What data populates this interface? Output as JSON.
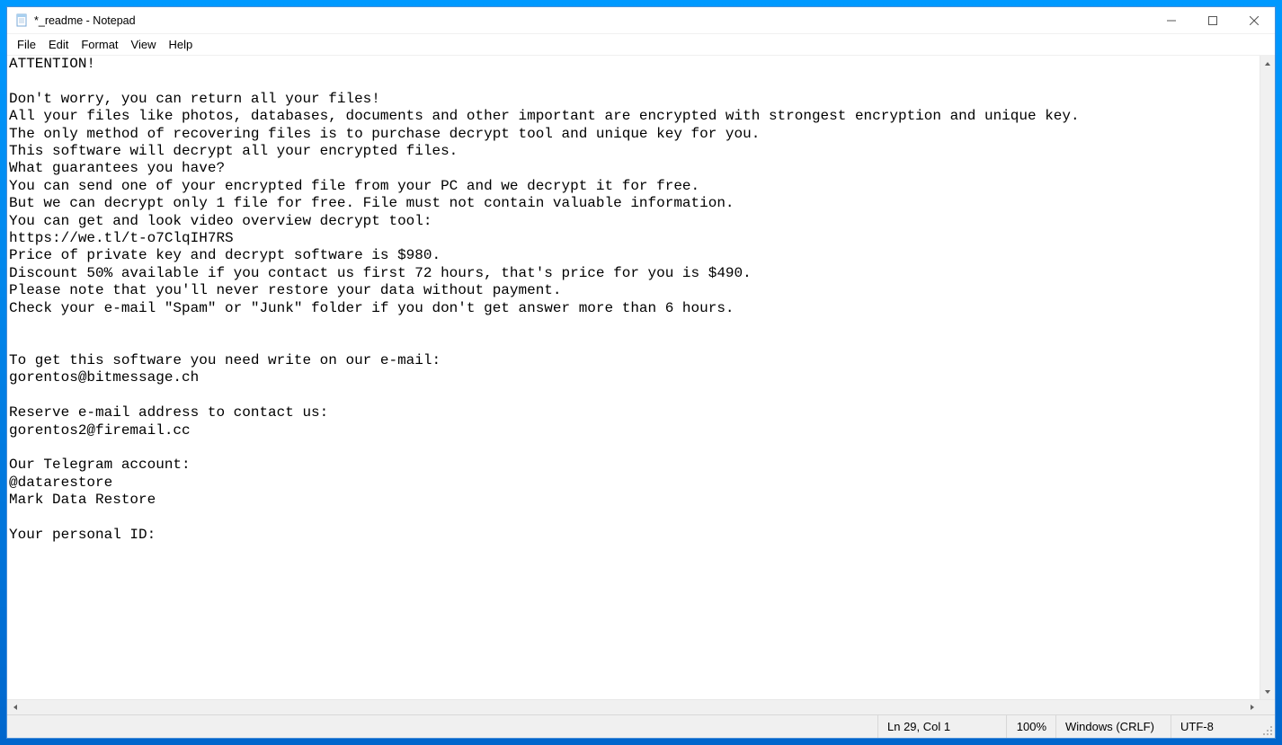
{
  "window": {
    "title": "*_readme - Notepad"
  },
  "menu": {
    "file": "File",
    "edit": "Edit",
    "format": "Format",
    "view": "View",
    "help": "Help"
  },
  "document": {
    "text": "ATTENTION!\n\nDon't worry, you can return all your files!\nAll your files like photos, databases, documents and other important are encrypted with strongest encryption and unique key.\nThe only method of recovering files is to purchase decrypt tool and unique key for you.\nThis software will decrypt all your encrypted files.\nWhat guarantees you have?\nYou can send one of your encrypted file from your PC and we decrypt it for free.\nBut we can decrypt only 1 file for free. File must not contain valuable information.\nYou can get and look video overview decrypt tool:\nhttps://we.tl/t-o7ClqIH7RS\nPrice of private key and decrypt software is $980.\nDiscount 50% available if you contact us first 72 hours, that's price for you is $490.\nPlease note that you'll never restore your data without payment.\nCheck your e-mail \"Spam\" or \"Junk\" folder if you don't get answer more than 6 hours.\n\n\nTo get this software you need write on our e-mail:\ngorentos@bitmessage.ch\n\nReserve e-mail address to contact us:\ngorentos2@firemail.cc\n\nOur Telegram account:\n@datarestore\nMark Data Restore\n\nYour personal ID:"
  },
  "statusbar": {
    "position": "Ln 29, Col 1",
    "zoom": "100%",
    "line_ending": "Windows (CRLF)",
    "encoding": "UTF-8"
  }
}
